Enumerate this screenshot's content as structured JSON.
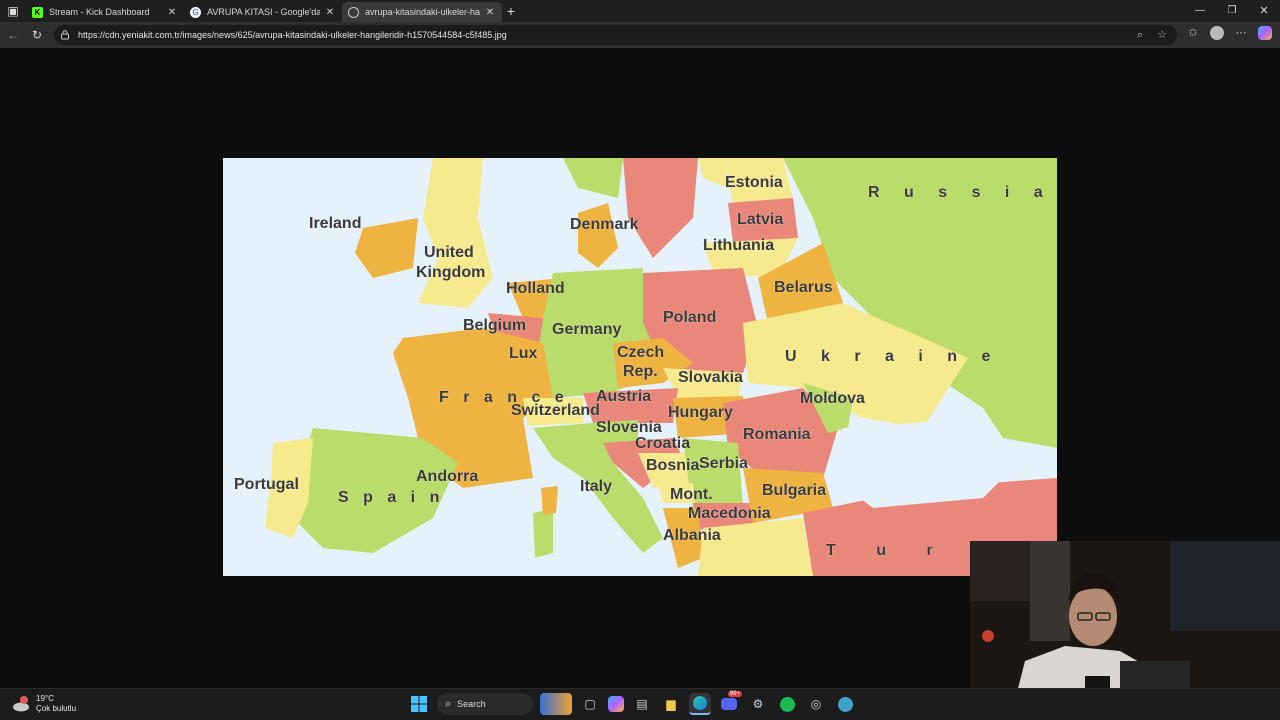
{
  "browser": {
    "tabs": [
      {
        "label": "Stream - Kick Dashboard",
        "icon": "kick-icon"
      },
      {
        "label": "AVRUPA KITASI - Google'da Ara",
        "icon": "google-icon"
      },
      {
        "label": "avrupa-kitasindaki-ulkeler-hangil...",
        "icon": "globe-icon"
      }
    ],
    "new_tab_label": "+",
    "url": "https://cdn.yeniakit.com.tr/images/news/625/avrupa-kitasindaki-ulkeler-hangileridir-h1570544584-c5f485.jpg"
  },
  "map_labels": {
    "russia": "R u s s i a",
    "estonia": "Estonia",
    "latvia": "Latvia",
    "lithuania": "Lithuania",
    "ireland": "Ireland",
    "united": "United",
    "kingdom": "Kingdom",
    "denmark": "Denmark",
    "holland": "Holland",
    "belarus": "Belarus",
    "poland": "Poland",
    "belgium": "Belgium",
    "germany": "Germany",
    "lux": "Lux",
    "czech": "Czech",
    "rep": "Rep.",
    "slovakia": "Slovakia",
    "ukraine": "U k r a i n e",
    "france": "F r a n c e",
    "switzerland": "Switzerland",
    "austria": "Austria",
    "hungary": "Hungary",
    "moldova": "Moldova",
    "slovenia": "Slovenia",
    "croatia": "Croatia",
    "romania": "Romania",
    "bosnia": "Bosnia",
    "serbia": "Serbia",
    "portugal": "Portugal",
    "spain": "S p a i n",
    "andorra": "Andorra",
    "italy": "Italy",
    "mont": "Mont.",
    "macedonia": "Macedonia",
    "bulgaria": "Bulgaria",
    "albania": "Albania",
    "turk": "T u r k"
  },
  "taskbar": {
    "temperature": "19°C",
    "weather_desc": "Çok bulutlu",
    "search_label": "Search",
    "notification_badge": "99+"
  },
  "colors": {
    "red": "#e9887a",
    "orange": "#eeb341",
    "yellow": "#f6ea8f",
    "green": "#b9dc6a",
    "sea": "#e6f2fb"
  }
}
